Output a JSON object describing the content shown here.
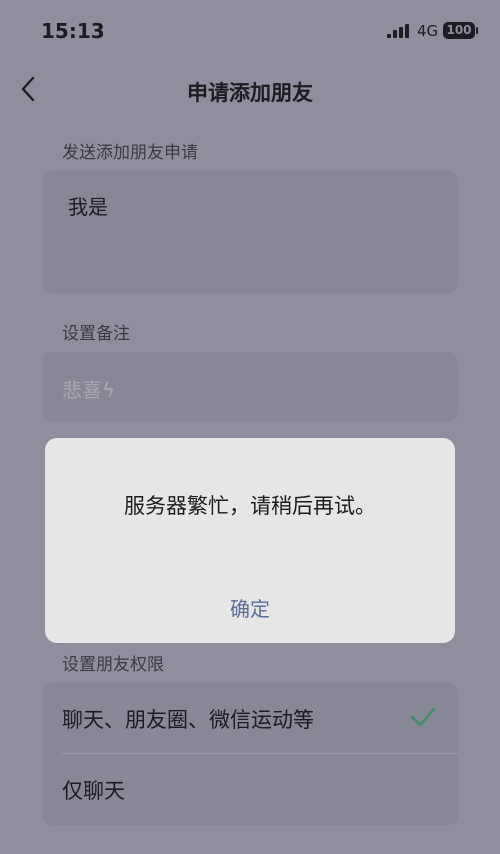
{
  "status_bar": {
    "time": "15:13",
    "network": "4G",
    "battery": "100",
    "signal_icon": "cellular-signal-icon"
  },
  "nav": {
    "title": "申请添加朋友",
    "back_icon": "chevron-left-icon"
  },
  "request": {
    "label": "发送添加朋友申请",
    "value": "我是"
  },
  "remark": {
    "label": "设置备注",
    "placeholder": "悲喜ϟ"
  },
  "permissions": {
    "label": "设置朋友权限",
    "options": [
      {
        "label": "聊天、朋友圈、微信运动等",
        "selected": true
      },
      {
        "label": "仅聊天",
        "selected": false
      }
    ],
    "check_icon": "checkmark-icon",
    "check_color": "#3e8e6b"
  },
  "dialog": {
    "message": "服务器繁忙，请稍后再试。",
    "confirm_label": "确定",
    "confirm_color": "#5a6d9b"
  }
}
